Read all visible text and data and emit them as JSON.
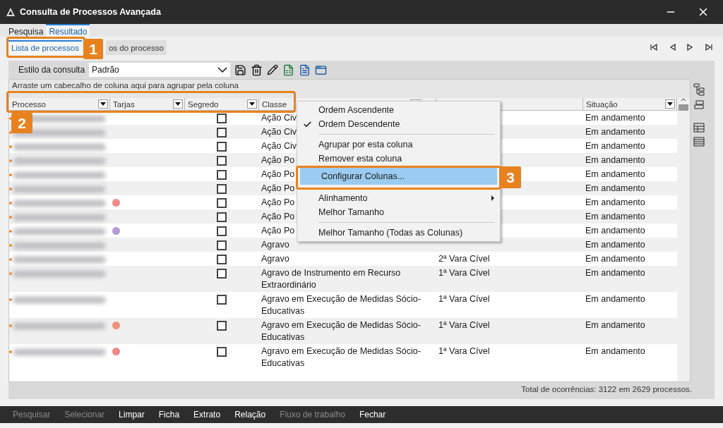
{
  "window": {
    "title": "Consulta de Processos Avançada"
  },
  "tabs": [
    {
      "label": "Pesquisa",
      "selected": false
    },
    {
      "label": "Resultado",
      "selected": true
    }
  ],
  "sub_tabs": [
    {
      "label": "Lista de processos",
      "selected": true
    },
    {
      "label": "os do processo",
      "selected": false
    }
  ],
  "toolbar": {
    "label": "Estilo da consulta",
    "value": "Padrão"
  },
  "grid": {
    "group_hint": "Arraste um cabecalho de coluna aqui para agrupar pela coluna",
    "columns": [
      "Processo",
      "Tarjas",
      "Segredo",
      "Classe",
      "Situação"
    ],
    "rows": [
      {
        "secret": false,
        "classe": "Ação Civ",
        "situacao": "Em andamento"
      },
      {
        "secret": false,
        "classe": "Ação Civ",
        "situacao": "Em andamento"
      },
      {
        "secret": false,
        "classe": "Ação Civ",
        "situacao": "Em andamento"
      },
      {
        "secret": false,
        "classe": "Ação Po",
        "situacao": "Em andamento"
      },
      {
        "secret": false,
        "classe": "Ação Po",
        "situacao": "Em andamento"
      },
      {
        "secret": false,
        "classe": "Ação Po",
        "situacao": "Em andamento"
      },
      {
        "tarja": {
          "color": "#f08a8a"
        },
        "secret": false,
        "classe": "Ação Po",
        "situacao": "Em andamento"
      },
      {
        "secret": false,
        "classe": "Ação Po",
        "situacao": "Em andamento"
      },
      {
        "tarja": {
          "color": "#b49ad8"
        },
        "secret": false,
        "classe": "Ação Po",
        "situacao": "Em andamento"
      },
      {
        "secret": false,
        "classe": "Agravo",
        "situacao": "Em andamento"
      },
      {
        "secret": false,
        "classe": "Agravo",
        "vara": "2ª Vara Cível",
        "situacao": "Em andamento"
      },
      {
        "secret": false,
        "classe": "Agravo de Instrumento em Recurso Extraordinário",
        "vara": "1ª Vara Cível",
        "situacao": "Em andamento"
      },
      {
        "secret": false,
        "classe": "Agravo em Execução de Medidas Sócio-Educativas",
        "vara": "1ª Vara Cível",
        "situacao": "Em andamento"
      },
      {
        "tarja": {
          "color": "#f2907a"
        },
        "secret": false,
        "classe": "Agravo em Execução de Medidas Sócio-Educativas",
        "vara": "1ª Vara Cível",
        "situacao": "Em andamento"
      },
      {
        "tarja": {
          "color": "#f08a8a"
        },
        "secret": false,
        "classe": "Agravo em Execução de Medidas Sócio-Educativas",
        "vara": "1ª Vara Cível",
        "situacao": "Em andamento"
      }
    ],
    "total": "Total de ocorrências: 3122 em 2629 processos."
  },
  "context_menu": [
    {
      "kind": "item",
      "label": "Ordem Ascendente",
      "checked": false,
      "selected": false
    },
    {
      "kind": "item",
      "label": "Ordem Descendente",
      "checked": true,
      "selected": false
    },
    {
      "kind": "separator"
    },
    {
      "kind": "item",
      "label": "Agrupar por esta coluna",
      "checked": false,
      "selected": false
    },
    {
      "kind": "item",
      "label": "Remover esta coluna",
      "checked": false,
      "selected": false
    },
    {
      "kind": "item",
      "label": "Configurar Colunas...",
      "checked": false,
      "selected": true
    },
    {
      "kind": "separator"
    },
    {
      "kind": "submenu",
      "label": "Alinhamento",
      "checked": false,
      "selected": false
    },
    {
      "kind": "item",
      "label": "Melhor Tamanho",
      "checked": false,
      "selected": false
    },
    {
      "kind": "separator"
    },
    {
      "kind": "item",
      "label": "Melhor Tamanho (Todas as Colunas)",
      "checked": false,
      "selected": false
    }
  ],
  "bottom_bar": [
    {
      "label": "Pesquisar",
      "disabled": true
    },
    {
      "label": "Selecionar",
      "disabled": true
    },
    {
      "label": "Limpar",
      "disabled": false
    },
    {
      "label": "Ficha",
      "disabled": false
    },
    {
      "label": "Extrato",
      "disabled": false
    },
    {
      "label": "Relação",
      "disabled": false
    },
    {
      "label": "Fluxo de trabalho",
      "disabled": true
    },
    {
      "label": "Fechar",
      "disabled": false
    }
  ],
  "annotations": [
    "1",
    "2",
    "3"
  ]
}
